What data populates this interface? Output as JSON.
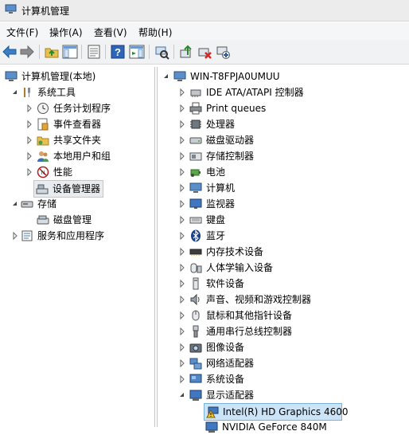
{
  "window": {
    "title": "计算机管理"
  },
  "menu": [
    {
      "label": "文件(F)"
    },
    {
      "label": "操作(A)"
    },
    {
      "label": "查看(V)"
    },
    {
      "label": "帮助(H)"
    }
  ],
  "left_tree": {
    "root": "计算机管理(本地)",
    "system_tools": "系统工具",
    "task_scheduler": "任务计划程序",
    "event_viewer": "事件查看器",
    "shared_folders": "共享文件夹",
    "local_users": "本地用户和组",
    "performance": "性能",
    "device_manager": "设备管理器",
    "storage": "存储",
    "disk_management": "磁盘管理",
    "services_apps": "服务和应用程序"
  },
  "right_tree": {
    "root": "WIN-T8FPJA0UMUU",
    "categories": [
      "IDE ATA/ATAPI 控制器",
      "Print queues",
      "处理器",
      "磁盘驱动器",
      "存储控制器",
      "电池",
      "计算机",
      "监视器",
      "键盘",
      "蓝牙",
      "内存技术设备",
      "人体学输入设备",
      "软件设备",
      "声音、视频和游戏控制器",
      "鼠标和其他指针设备",
      "通用串行总线控制器",
      "图像设备",
      "网络适配器",
      "系统设备",
      "显示适配器"
    ],
    "display_children": [
      "Intel(R) HD Graphics 4600",
      "NVIDIA GeForce 840M"
    ]
  }
}
